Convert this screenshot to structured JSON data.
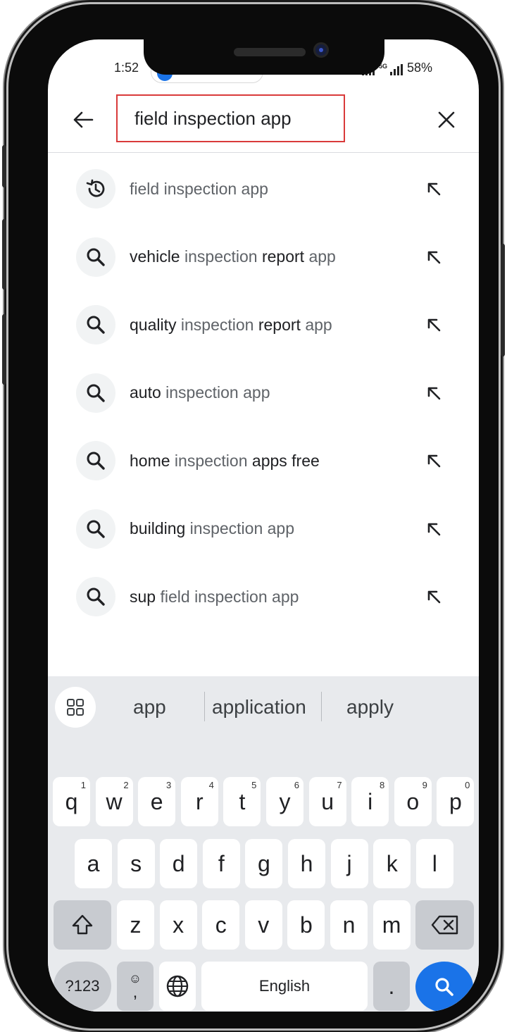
{
  "status_bar": {
    "time": "1:52",
    "network": "5G",
    "battery": "58%"
  },
  "search": {
    "query": "field inspection app"
  },
  "suggestions": [
    {
      "type": "history",
      "highlight": "",
      "rest": "field inspection app"
    },
    {
      "type": "search",
      "highlight": "vehicle",
      "rest": " inspection ",
      "highlight2": "report",
      "rest2": " app"
    },
    {
      "type": "search",
      "highlight": "quality",
      "rest": " inspection ",
      "highlight2": "report",
      "rest2": " app"
    },
    {
      "type": "search",
      "highlight": "auto",
      "rest": " inspection app",
      "highlight2": "",
      "rest2": ""
    },
    {
      "type": "search",
      "highlight": "home",
      "rest": " inspection ",
      "highlight2": "apps free",
      "rest2": ""
    },
    {
      "type": "search",
      "highlight": "building",
      "rest": " inspection app",
      "highlight2": "",
      "rest2": ""
    },
    {
      "type": "search",
      "highlight": "sup",
      "rest": " field inspection app",
      "highlight2": "",
      "rest2": ""
    }
  ],
  "keyboard": {
    "predictions": [
      "app",
      "application",
      "apply"
    ],
    "row1": [
      "q",
      "w",
      "e",
      "r",
      "t",
      "y",
      "u",
      "i",
      "o",
      "p"
    ],
    "row1_numbers": [
      "1",
      "2",
      "3",
      "4",
      "5",
      "6",
      "7",
      "8",
      "9",
      "0"
    ],
    "row2": [
      "a",
      "s",
      "d",
      "f",
      "g",
      "h",
      "j",
      "k",
      "l"
    ],
    "row3": [
      "z",
      "x",
      "c",
      "v",
      "b",
      "n",
      "m"
    ],
    "symbols_label": "?123",
    "emoji_comma_label": ",",
    "space_label": "English",
    "period_label": "."
  },
  "colors": {
    "accent": "#1a73e8",
    "highlight_border": "#d93a3a"
  }
}
